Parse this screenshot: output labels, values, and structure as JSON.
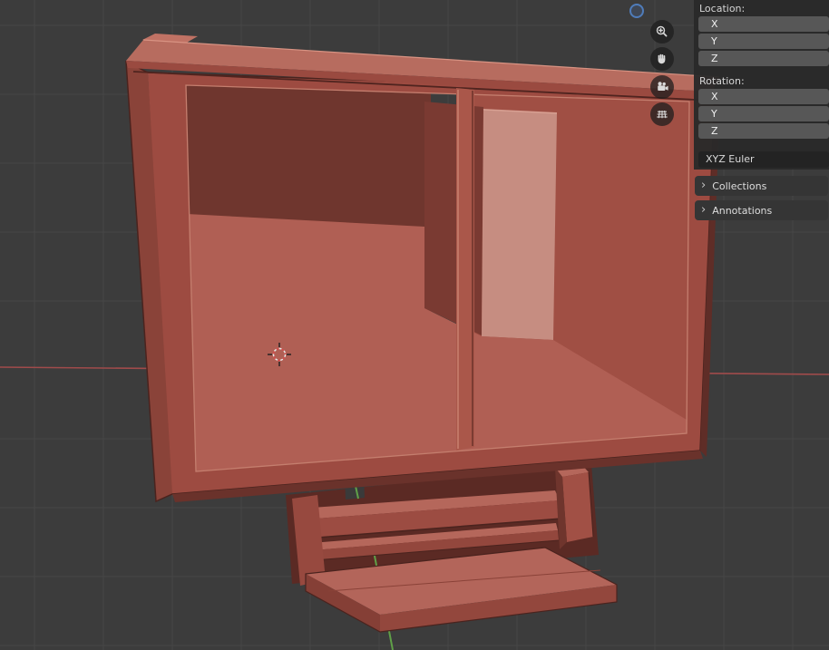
{
  "sidebar": {
    "location_label": "Location:",
    "rotation_label": "Rotation:",
    "location_axes": [
      "X",
      "Y",
      "Z"
    ],
    "rotation_axes": [
      "X",
      "Y",
      "Z"
    ],
    "rotation_mode": "XYZ Euler",
    "sections": [
      {
        "label": "Collections"
      },
      {
        "label": "Annotations"
      }
    ],
    "chevron": "›"
  },
  "gizmo_buttons": [
    {
      "name": "zoom-icon"
    },
    {
      "name": "pan-hand-icon"
    },
    {
      "name": "camera-view-icon"
    },
    {
      "name": "toggle-projection-grid-icon"
    }
  ],
  "colors": {
    "viewport_bg": "#3c3c3c",
    "grid_line": "#464646",
    "axis_x": "#a04b4b",
    "axis_y": "#60a048",
    "cab_front": "#9d4b41",
    "cab_left": "#8a4339",
    "lip_top": "#b76c5f",
    "lip_front": "#9a4a40",
    "lip_step": "#c07264",
    "edge_dark": "#4a231e",
    "edge_light": "#c47e6e",
    "interior_back_wall": "#6f362e",
    "interior_right_wall": "#a04f44",
    "panel_dark": "#7a3a32",
    "panel_pink": "#c68d81",
    "floor": "#b05f54",
    "mullion": "#aa574a",
    "mullion_light": "#d08a7a",
    "mullion_dark": "#5c2b24",
    "sill": "#6a322b",
    "right_sliver": "#5f2d27",
    "base_shadow": "#5b2a24",
    "base_gap": "#3a3a3a",
    "rail_top": "#b5675b",
    "rail_front": "#9c4c42",
    "post_front": "#a15045",
    "post_side": "#6f352d",
    "support": "#97493f",
    "sled_top": "#b3655a",
    "sled_front": "#93473d",
    "sled_side": "#853f36",
    "cursor_red": "#d84b4b",
    "cursor_white": "#e8e8e8",
    "nav_gizmo_blue": "#4f7cba",
    "panel_field_bg": "#575757",
    "panel_dropdown_bg": "#232323",
    "panel_header_bg": "#353535",
    "panel_text": "#d6d6d6"
  }
}
